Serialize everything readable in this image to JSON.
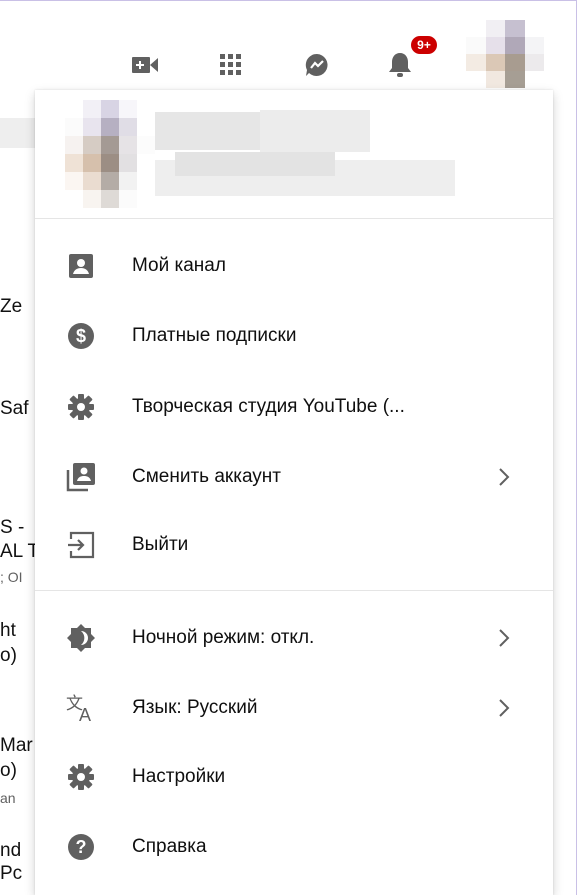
{
  "colors": {
    "icon": "#606060",
    "text": "#0f0f0f",
    "badge": "#cc0000",
    "frame": "#c9c0e6"
  },
  "topbar": {
    "icons": [
      "video-camera-icon",
      "apps-grid-icon",
      "messages-icon",
      "notifications-bell-icon"
    ],
    "notification_badge": "9+"
  },
  "background_fragments": [
    "Ze",
    "Saf",
    "S -",
    "AL T",
    "; OI",
    "ht",
    "o)",
    "Mar",
    "o)",
    "an",
    "nd",
    "Pc"
  ],
  "menu": {
    "section1": [
      {
        "label": "Мой канал",
        "icon": "account-box-icon",
        "chevron": false
      },
      {
        "label": "Платные подписки",
        "icon": "paid-dollar-icon",
        "chevron": false
      },
      {
        "label": "Творческая студия YouTube (...",
        "icon": "gear-icon",
        "chevron": false
      },
      {
        "label": "Сменить аккаунт",
        "icon": "switch-account-icon",
        "chevron": true
      },
      {
        "label": "Выйти",
        "icon": "exit-icon",
        "chevron": false
      }
    ],
    "section2": [
      {
        "label": "Ночной режим: откл.",
        "icon": "dark-mode-icon",
        "chevron": true
      },
      {
        "label": "Язык: Русский",
        "icon": "translate-icon",
        "chevron": true
      },
      {
        "label": "Настройки",
        "icon": "gear-icon",
        "chevron": false
      },
      {
        "label": "Справка",
        "icon": "help-icon",
        "chevron": false
      }
    ]
  }
}
